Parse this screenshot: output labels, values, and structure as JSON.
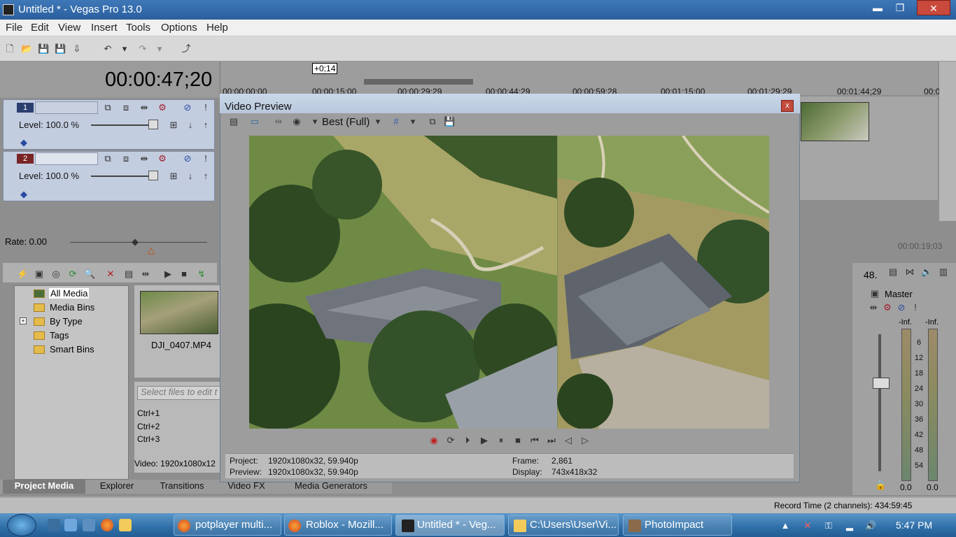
{
  "window": {
    "title": "Untitled * - Vegas Pro 13.0",
    "min": "▬",
    "max": "❐",
    "close": "✕"
  },
  "menu": [
    "File",
    "Edit",
    "View",
    "Insert",
    "Tools",
    "Options",
    "Help"
  ],
  "timecode": "00:00:47;20",
  "cursor_offset": "+0;14",
  "tracks": [
    {
      "num": "1",
      "level": "Level: 100.0 %"
    },
    {
      "num": "2",
      "level": "Level: 100.0 %"
    }
  ],
  "ruler_ticks": [
    "00:00:00;00",
    "00:00:15;00",
    "00:00:29;29",
    "00:00:44;29",
    "00:00:59;28",
    "00:01:15;00",
    "00:01:29;29",
    "00:01:44;29",
    "00:0"
  ],
  "rate": "Rate: 0.00",
  "media_tree": [
    "All Media",
    "Media Bins",
    "By Type",
    "Tags",
    "Smart Bins"
  ],
  "media_file": "DJI_0407.MP4",
  "select_files_placeholder": "Select files to edit t",
  "shortcuts": [
    "Ctrl+1",
    "Ctrl+2",
    "Ctrl+3"
  ],
  "video_info": "Video: 1920x1080x12",
  "tabs": [
    "Project Media",
    "Explorer",
    "Transitions",
    "Video FX",
    "Media Generators"
  ],
  "status": {
    "record_time": "Record Time (2 channels): 434:59:45"
  },
  "timeline_end_tc": "00:00:19;03",
  "master": {
    "label": "Master",
    "vol": "48.",
    "inf_left": "-Inf.",
    "inf_right": "-Inf.",
    "scale": [
      "6",
      "12",
      "18",
      "24",
      "30",
      "36",
      "42",
      "48",
      "54"
    ],
    "bottom_left": "0.0",
    "bottom_right": "0.0"
  },
  "preview": {
    "title": "Video Preview",
    "close": "x",
    "quality": "Best (Full)",
    "project_label": "Project:",
    "project_value": "1920x1080x32, 59.940p",
    "preview_label": "Preview:",
    "preview_value": "1920x1080x32, 59.940p",
    "frame_label": "Frame:",
    "frame_value": "2,861",
    "display_label": "Display:",
    "display_value": "743x418x32"
  },
  "taskbar": {
    "items": [
      "potplayer multi...",
      "Roblox - Mozill...",
      "Untitled * - Veg...",
      "C:\\Users\\User\\Vi...",
      "PhotoImpact"
    ],
    "clock": "5:47 PM"
  },
  "colors": {
    "title_bar": "#2a5f9e",
    "track_bg": "#c3cde0",
    "taskbar": "#2f6fa8"
  }
}
